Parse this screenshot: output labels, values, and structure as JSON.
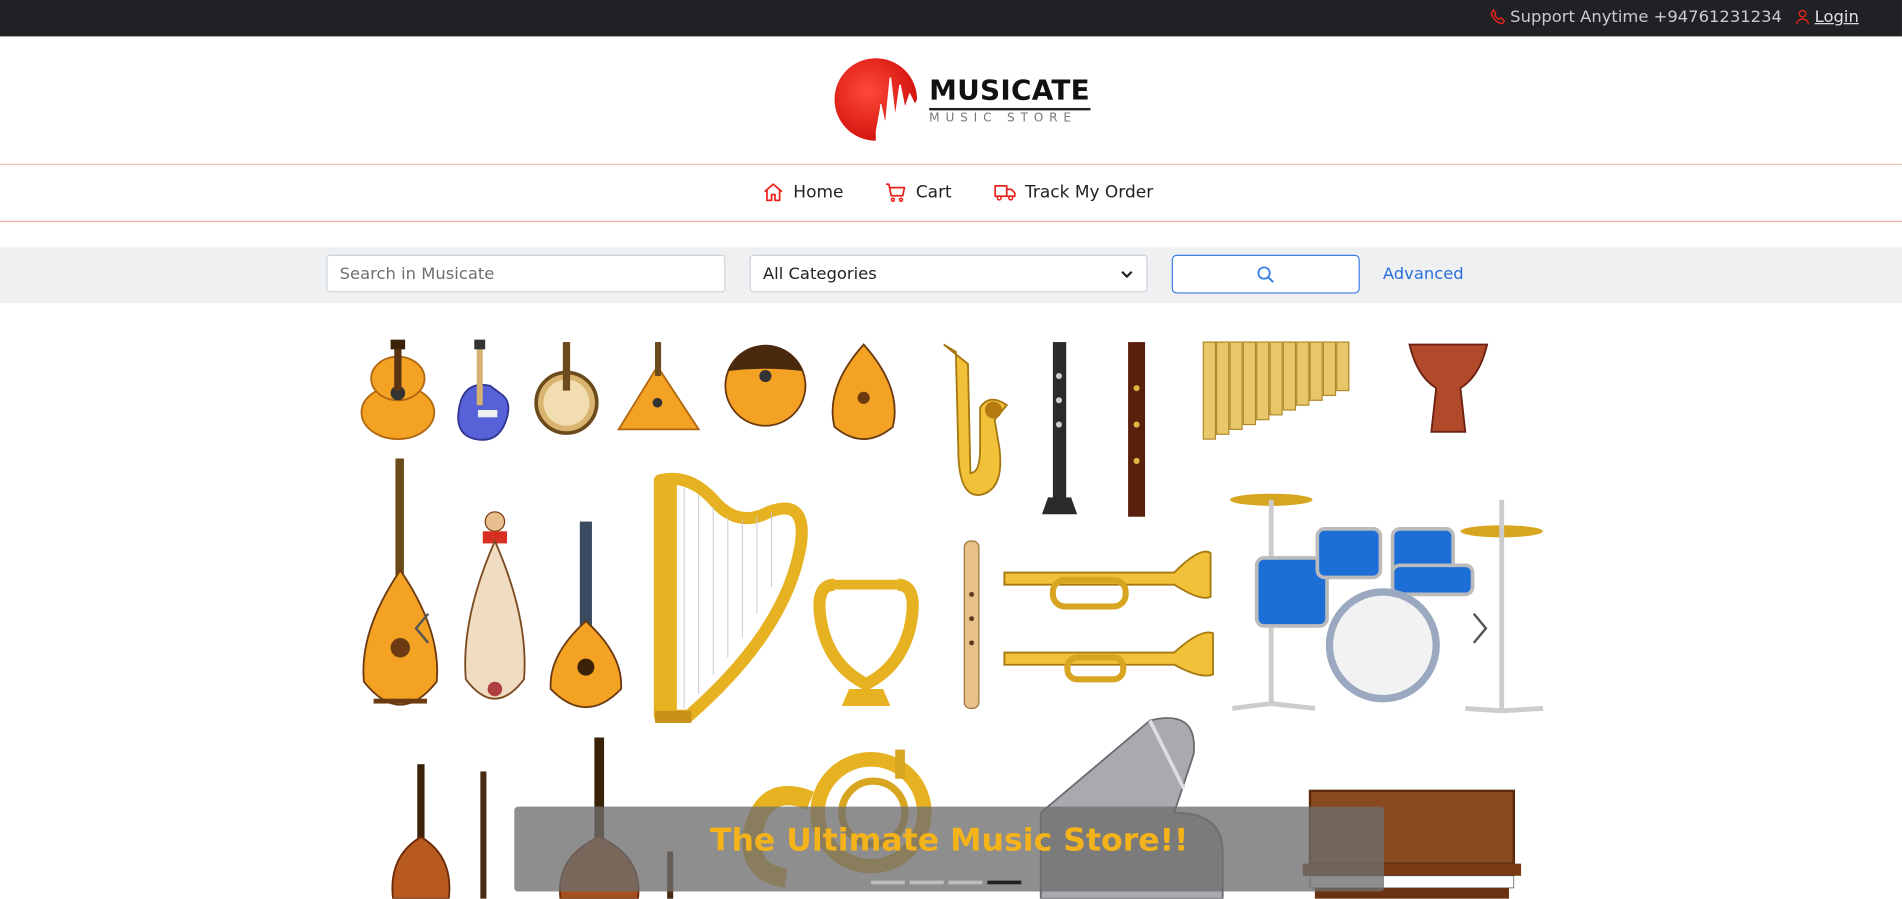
{
  "topbar": {
    "support_text": "Support Anytime +94761231234",
    "login_text": "Login",
    "phone_icon": "phone-icon",
    "user_icon": "user-icon"
  },
  "logo": {
    "title": "MUSICATE",
    "subtitle": "MUSIC STORE"
  },
  "nav": {
    "items": [
      {
        "label": "Home",
        "icon": "home-icon"
      },
      {
        "label": "Cart",
        "icon": "cart-icon"
      },
      {
        "label": "Track My Order",
        "icon": "truck-icon"
      }
    ]
  },
  "search": {
    "placeholder": "Search in Musicate",
    "category_selected": "All Categories",
    "advanced_label": "Advanced"
  },
  "hero": {
    "caption": "The Ultimate Music Store!!",
    "slide_count": 4,
    "active_slide": 4
  },
  "colors": {
    "topbar_bg": "#1f2125",
    "accent_red": "#e8231b",
    "link_blue": "#2a6fdc",
    "caption_gold": "#f4b21b",
    "search_band": "#eff0f2"
  }
}
